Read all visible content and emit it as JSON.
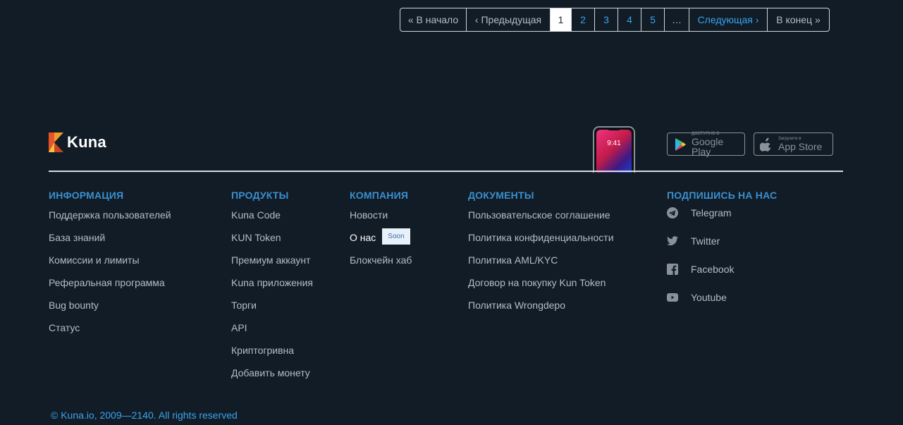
{
  "pagination": {
    "first": "« В начало",
    "prev": "‹ Предыдущая",
    "pages": [
      "1",
      "2",
      "3",
      "4",
      "5"
    ],
    "current": "1",
    "ellipsis": "…",
    "next": "Следующая ›",
    "last": "В конец »"
  },
  "footer": {
    "logo_text": "Kuna",
    "phone_time": "9:41",
    "google_play": {
      "small": "ДОСТУПНО В",
      "big": "Google Play"
    },
    "app_store": {
      "small": "Загрузите в",
      "big": "App Store"
    },
    "columns": {
      "info": {
        "title": "ИНФОРМАЦИЯ",
        "items": [
          "Поддержка пользователей",
          "База знаний",
          "Комиссии и лимиты",
          "Реферальная программа",
          "Bug bounty",
          "Статус"
        ]
      },
      "products": {
        "title": "ПРОДУКТЫ",
        "items": [
          "Kuna Code",
          "KUN Token",
          "Премиум аккаунт",
          "Kuna приложения",
          "Торги",
          "API",
          "Криптогривна",
          "Добавить монету"
        ]
      },
      "company": {
        "title": "КОМПАНИЯ",
        "items": [
          "Новости",
          "О нас",
          "Блокчейн хаб"
        ],
        "soon_badge": "Soon"
      },
      "docs": {
        "title": "ДОКУМЕНТЫ",
        "items": [
          "Пользовательское соглашение",
          "Политика конфиденциальности",
          "Политика AML/KYC",
          "Договор на покупку Kun Token",
          "Политика Wrongdepo"
        ]
      },
      "social": {
        "title": "ПОДПИШИСЬ НА НАС",
        "items": [
          {
            "label": "Telegram",
            "icon": "telegram-icon"
          },
          {
            "label": "Twitter",
            "icon": "twitter-icon"
          },
          {
            "label": "Facebook",
            "icon": "facebook-icon"
          },
          {
            "label": "Youtube",
            "icon": "youtube-icon"
          }
        ]
      }
    },
    "copyright": "© Kuna.io, 2009—2140. All rights reserved"
  },
  "colors": {
    "background": "#111c26",
    "accent": "#3aa3ef",
    "heading": "#3b8fd0",
    "text": "#b5bdc6"
  }
}
